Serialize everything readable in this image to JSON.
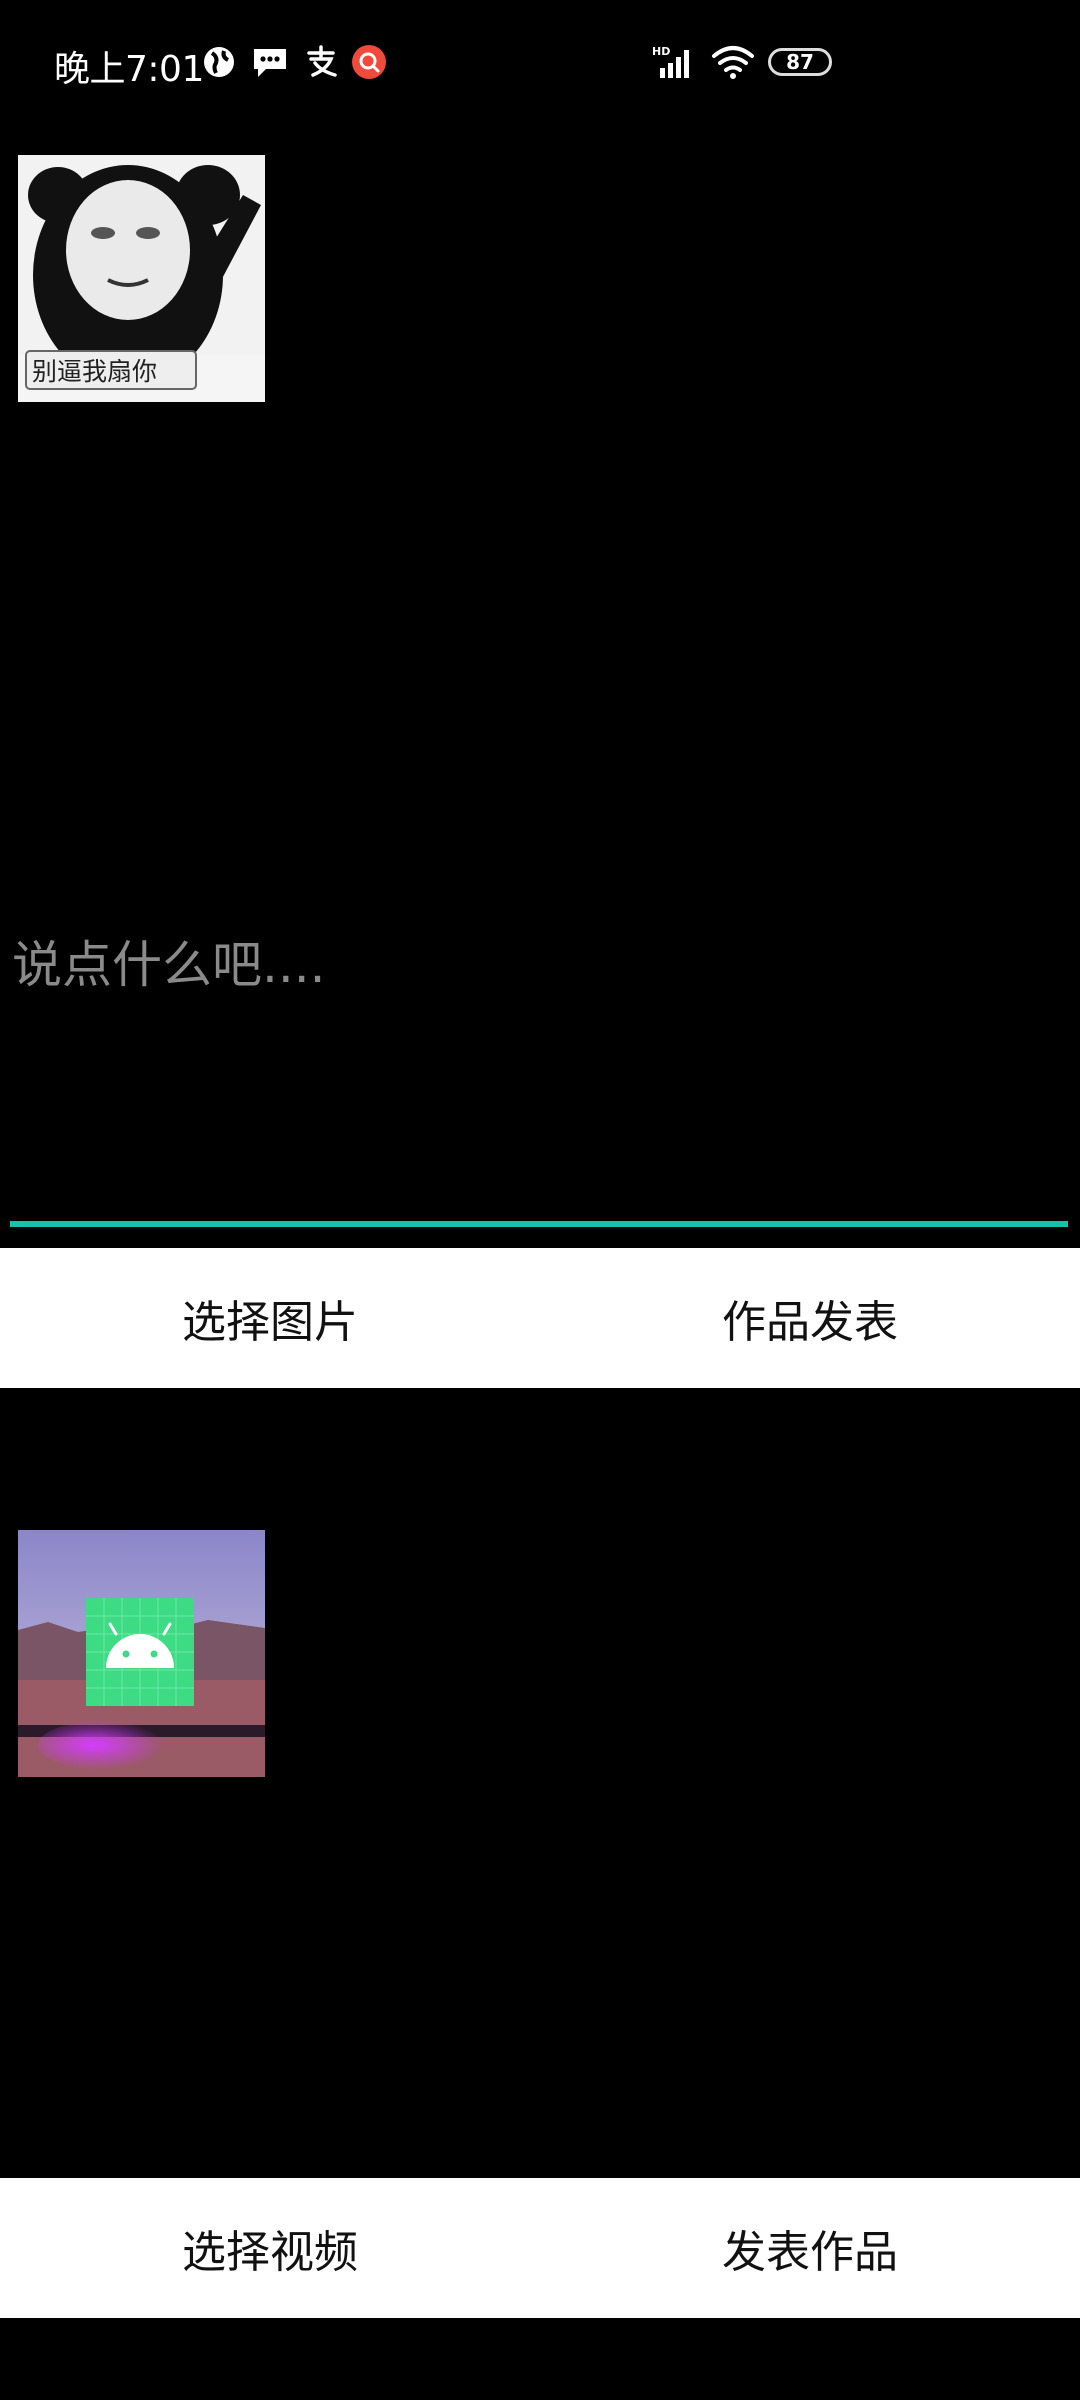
{
  "status_bar": {
    "time": "晚上7:01",
    "icons": [
      "globe-icon",
      "message-icon",
      "alipay-icon",
      "notification-icon"
    ],
    "network_label": "HD",
    "battery": "87"
  },
  "image_picker": {
    "thumbnail_caption": "别逼我扇你",
    "text_input_placeholder": "说点什么吧....",
    "select_image_label": "选择图片",
    "publish_label": "作品发表"
  },
  "video_picker": {
    "select_video_label": "选择视频",
    "publish_label": "发表作品"
  },
  "colors": {
    "accent_underline": "#17c2ad",
    "android_green": "#3ddc84",
    "background": "#000000",
    "button_bar": "#ffffff"
  }
}
